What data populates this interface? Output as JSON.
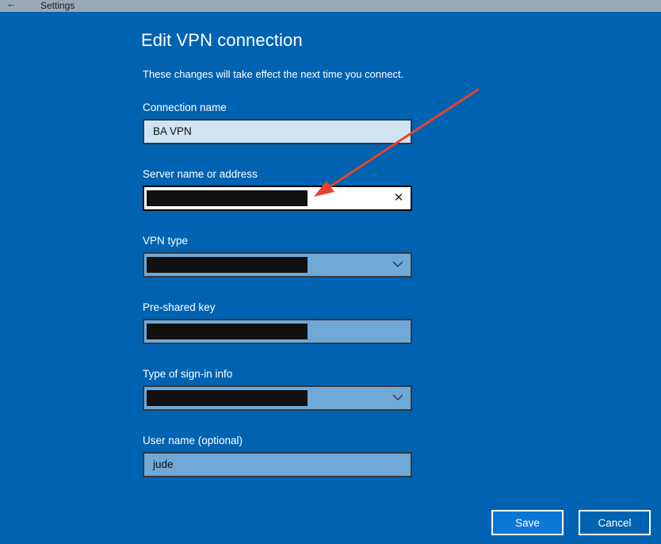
{
  "window": {
    "app_title": "Settings",
    "back_icon": "back-arrow-icon"
  },
  "dialog": {
    "title": "Edit VPN connection",
    "subtitle": "These changes will take effect the next time you connect."
  },
  "fields": {
    "connection_name": {
      "label": "Connection name",
      "value": "BA VPN"
    },
    "server": {
      "label": "Server name or address",
      "value": ""
    },
    "vpn_type": {
      "label": "VPN type",
      "value": ""
    },
    "psk": {
      "label": "Pre-shared key",
      "value": ""
    },
    "signin_type": {
      "label": "Type of sign-in info",
      "value": ""
    },
    "username": {
      "label": "User name (optional)",
      "value": "jude"
    }
  },
  "buttons": {
    "save": "Save",
    "cancel": "Cancel"
  },
  "colors": {
    "background": "#0063b1",
    "annotation_arrow": "#e8432a"
  }
}
